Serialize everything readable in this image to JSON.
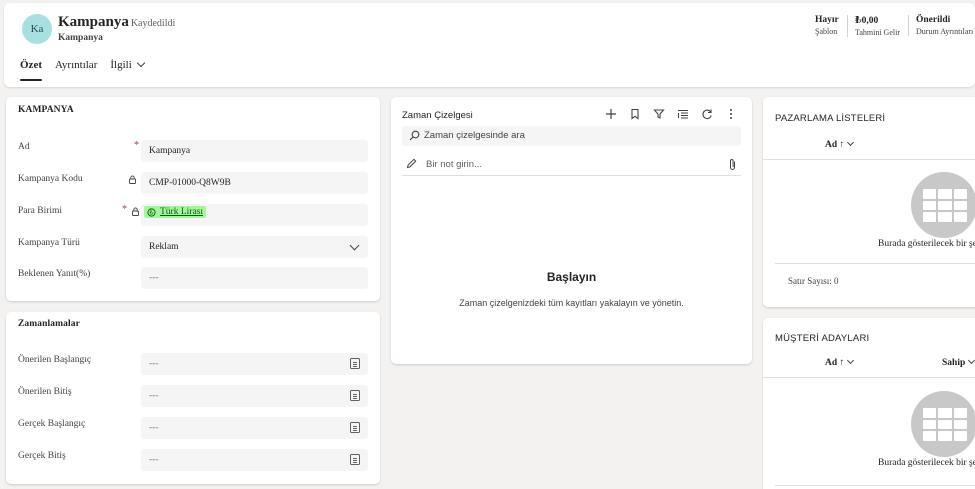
{
  "header": {
    "avatar_initials": "Ka",
    "title": "Kampanya",
    "save_status": "- Kaydedildi",
    "entity": "Kampanya",
    "fields": [
      {
        "value": "Hayır",
        "label": "Şablon"
      },
      {
        "value": "₺0,00",
        "label": "Tahmini Gelir"
      },
      {
        "value": "Önerildi",
        "label": "Durum Ayrıntıları"
      }
    ],
    "tabs": [
      "Özet",
      "Ayrıntılar",
      "İlgili"
    ]
  },
  "campaign_section": {
    "title": "KAMPANYA",
    "fields": [
      {
        "label": "Ad",
        "value": "Kampanya"
      },
      {
        "label": "Kampanya Kodu",
        "value": "CMP-01000-Q8W9B"
      },
      {
        "label": "Para Birimi",
        "value": "Türk Lirası"
      },
      {
        "label": "Kampanya Türü",
        "value": "Reklam"
      },
      {
        "label": "Beklenen Yanıt(%)",
        "value": "---"
      }
    ]
  },
  "schedule_section": {
    "title": "Zamanlamalar",
    "fields": [
      {
        "label": "Önerilen Başlangıç",
        "value": "---"
      },
      {
        "label": "Önerilen Bitiş",
        "value": "---"
      },
      {
        "label": "Gerçek Başlangıç",
        "value": "---"
      },
      {
        "label": "Gerçek Bitiş",
        "value": "---"
      }
    ]
  },
  "timeline": {
    "title": "Zaman Çizelgesi",
    "search_placeholder": "Zaman çizelgesinde ara",
    "note_placeholder": "Bir not girin...",
    "empty_title": "Başlayın",
    "empty_desc": "Zaman çizelgenizdeki tüm kayıtları yakalayın ve yönetin."
  },
  "marketing_lists": {
    "title": "PAZARLAMA LİSTELERİ",
    "col_name": "Ad ↑",
    "empty_text": "Burada gösterilecek bir şey",
    "row_count": "Satır Sayısı: 0"
  },
  "leads": {
    "title": "MÜŞTERİ ADAYLARI",
    "col_name": "Ad ↑",
    "col_owner": "Sahip",
    "empty_text": "Burada gösterilecek bir şey"
  },
  "colors": {
    "avatar_bg": "#a8dfe0",
    "lookup_bg": "#a4f69a",
    "required": "#c4314b"
  }
}
